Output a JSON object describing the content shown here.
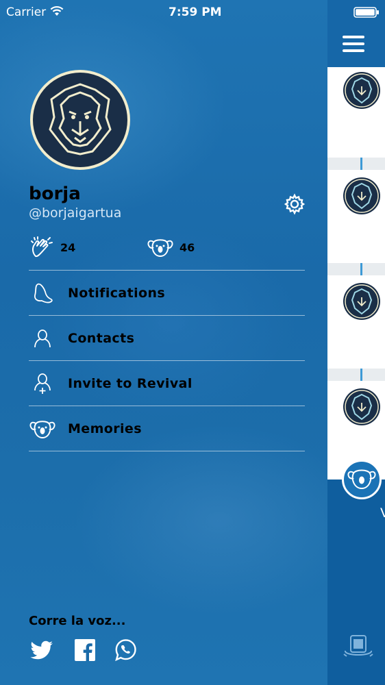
{
  "status_bar": {
    "carrier": "Carrier",
    "time": "7:59 PM"
  },
  "profile": {
    "name": "borja",
    "handle": "@borjaigartua"
  },
  "stats": {
    "claps": "24",
    "koalas": "46"
  },
  "menu": {
    "items": [
      {
        "label": "Notifications",
        "icon": "bell-icon"
      },
      {
        "label": "Contacts",
        "icon": "person-icon"
      },
      {
        "label": "Invite to Revival",
        "icon": "add-person-icon"
      },
      {
        "label": "Memories",
        "icon": "koala-icon"
      }
    ]
  },
  "share": {
    "label": "Corre la voz...",
    "networks": [
      "twitter-icon",
      "facebook-icon",
      "whatsapp-icon"
    ]
  },
  "panel": {
    "partial_text": "V"
  },
  "colors": {
    "drawer_bg": "#1a6aa8",
    "panel_bg": "#0f5e9e",
    "accent": "#3e9ad6",
    "lion_bg": "#1a2e47",
    "lion_line": "#f4efcf"
  }
}
